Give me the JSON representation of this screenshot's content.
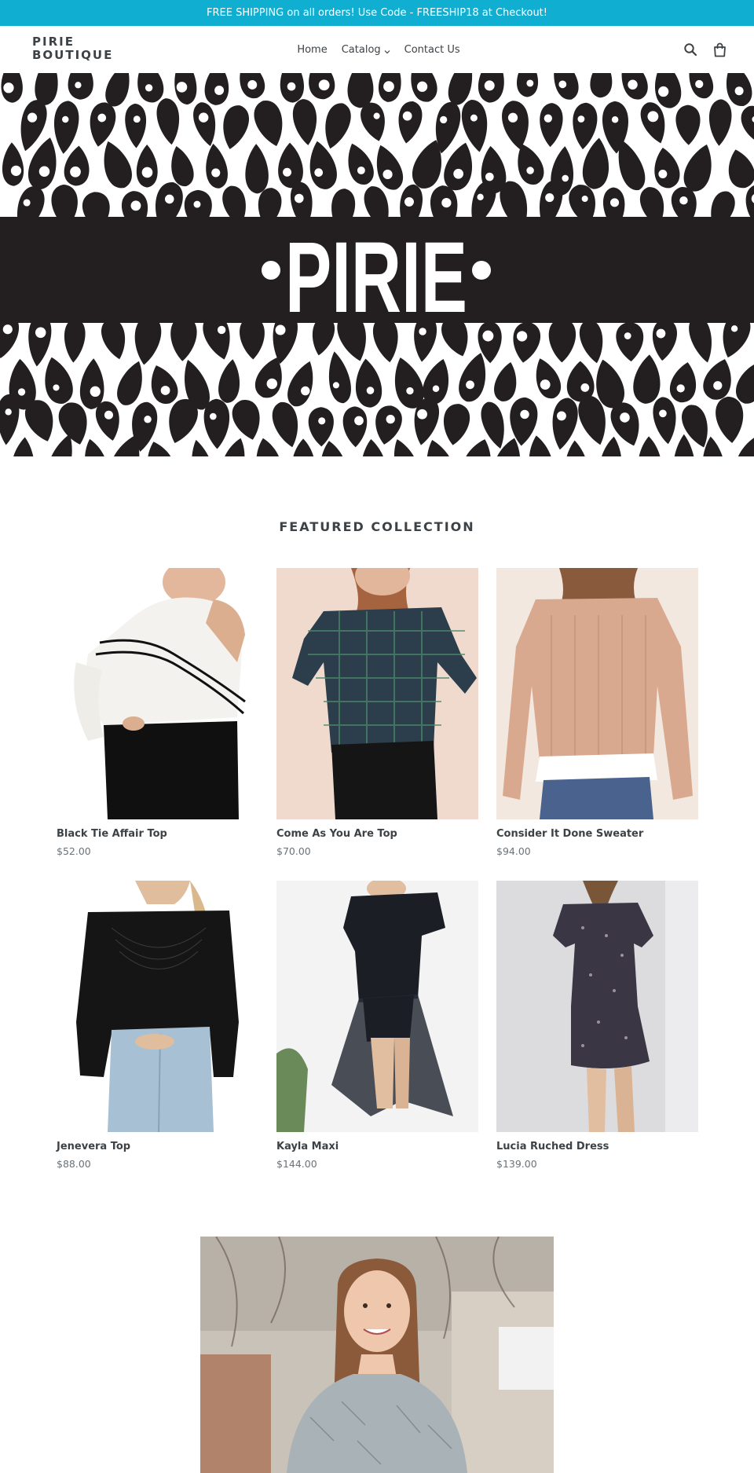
{
  "announcement": {
    "text": "FREE SHIPPING on all orders! Use Code - FREESHIP18 at Checkout!",
    "background": "#10aed1"
  },
  "header": {
    "logo_line1": "PIRIE",
    "logo_line2": "BOUTIQUE",
    "nav": [
      {
        "label": "Home"
      },
      {
        "label": "Catalog",
        "has_dropdown": true
      },
      {
        "label": "Contact Us"
      }
    ],
    "icons": [
      "search-icon",
      "cart-icon"
    ]
  },
  "hero": {
    "brand_text": "PIRIE",
    "pattern_color": "#231f20",
    "band_color": "#231f20"
  },
  "featured": {
    "title": "FEATURED COLLECTION",
    "products": [
      {
        "title": "Black Tie Affair Top",
        "price": "$52.00",
        "image": "white one-shoulder ruffle top with black pants"
      },
      {
        "title": "Come As You Are Top",
        "price": "$70.00",
        "image": "green plaid off-shoulder top"
      },
      {
        "title": "Consider It Done Sweater",
        "price": "$94.00",
        "image": "tan knit sweater with white hem"
      },
      {
        "title": "Jenevera Top",
        "price": "$88.00",
        "image": "black lace top with jeans"
      },
      {
        "title": "Kayla Maxi",
        "price": "$144.00",
        "image": "black one-shoulder sheer maxi dress"
      },
      {
        "title": "Lucia Ruched Dress",
        "price": "$139.00",
        "image": "dark printed ruched mini dress"
      }
    ]
  },
  "owner_photo": {
    "image": "smiling woman with long brown hair outdoors"
  }
}
